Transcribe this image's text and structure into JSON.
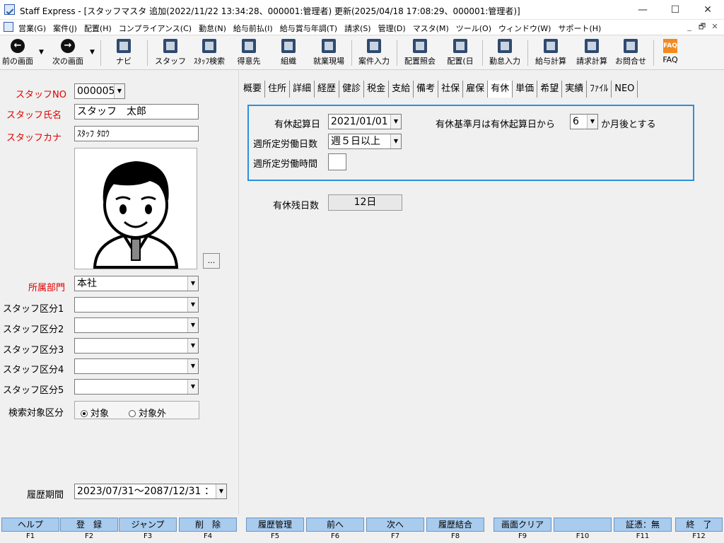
{
  "window": {
    "title": "Staff Express - [スタッフマスタ 追加(2022/11/22 13:34:28、000001:管理者) 更新(2025/04/18 17:08:29、000001:管理者)]",
    "minimize": "—",
    "maximize": "☐",
    "close": "✕"
  },
  "menu": {
    "items": [
      "営業(G)",
      "案件(J)",
      "配置(H)",
      "コンプライアンス(C)",
      "勤怠(N)",
      "給与前払(I)",
      "給与賞与年調(T)",
      "請求(S)",
      "管理(D)",
      "マスタ(M)",
      "ツール(O)",
      "ウィンドウ(W)",
      "サポート(H)"
    ],
    "mdi_min": "_",
    "mdi_restore": "🗗",
    "mdi_close": "✕"
  },
  "toolbar": {
    "prev": "前の画面",
    "next": "次の画面",
    "navi": "ナビ",
    "staff": "スタッフ",
    "staff_search": "ｽﾀｯﾌ検索",
    "client": "得意先",
    "org": "組織",
    "site": "就業現場",
    "job_entry": "案件入力",
    "assign_inquiry": "配置照会",
    "assign_day": "配置(日",
    "attendance": "勤怠入力",
    "payroll": "給与計算",
    "billing": "請求計算",
    "contact": "お問合せ",
    "faq": "FAQ",
    "faq_icon": "FAQ"
  },
  "left": {
    "staff_no_label": "スタッフNO",
    "staff_no": "000005",
    "staff_name_label": "スタッフ氏名",
    "staff_name": "スタッフ　太郎",
    "staff_kana_label": "スタッフカナ",
    "staff_kana": "ｽﾀｯﾌ ﾀﾛｳ",
    "photo_btn": "...",
    "dept_label": "所属部門",
    "dept": "本社",
    "class1_label": "スタッフ区分1",
    "class2_label": "スタッフ区分2",
    "class3_label": "スタッフ区分3",
    "class4_label": "スタッフ区分4",
    "class5_label": "スタッフ区分5",
    "search_target_label": "検索対象区分",
    "radio_target": "対象",
    "radio_non_target": "対象外",
    "history_label": "履歴期間",
    "history_value": "2023/07/31～2087/12/31 ："
  },
  "tabs": [
    "概要",
    "住所",
    "詳細",
    "経歴",
    "健診",
    "税金",
    "支給",
    "備考",
    "社保",
    "雇保",
    "有休",
    "単価",
    "希望",
    "実績",
    "ﾌｧｲﾙ",
    "NEO"
  ],
  "leave": {
    "start_date_label": "有休起算日",
    "start_date": "2021/01/01",
    "base_month_label": "有休基準月は有休起算日から",
    "base_month_value": "6",
    "base_month_suffix": "か月後とする",
    "weekly_days_label": "週所定労働日数",
    "weekly_days_value": "週５日以上",
    "weekly_hours_label": "週所定労働時間",
    "weekly_hours_value": "",
    "remaining_label": "有休残日数",
    "remaining_value": "12日"
  },
  "fkeys": [
    {
      "label": "ヘルプ",
      "key": "F1"
    },
    {
      "label": "登　録",
      "key": "F2"
    },
    {
      "label": "ジャンプ",
      "key": "F3"
    },
    {
      "label": "削　除",
      "key": "F4"
    },
    {
      "label": "履歴管理",
      "key": "F5"
    },
    {
      "label": "前へ",
      "key": "F6"
    },
    {
      "label": "次へ",
      "key": "F7"
    },
    {
      "label": "履歴結合",
      "key": "F8"
    },
    {
      "label": "画面クリア",
      "key": "F9"
    },
    {
      "label": "",
      "key": "F10"
    },
    {
      "label": "証憑：無",
      "key": "F11"
    },
    {
      "label": "終　了",
      "key": "F12"
    }
  ]
}
